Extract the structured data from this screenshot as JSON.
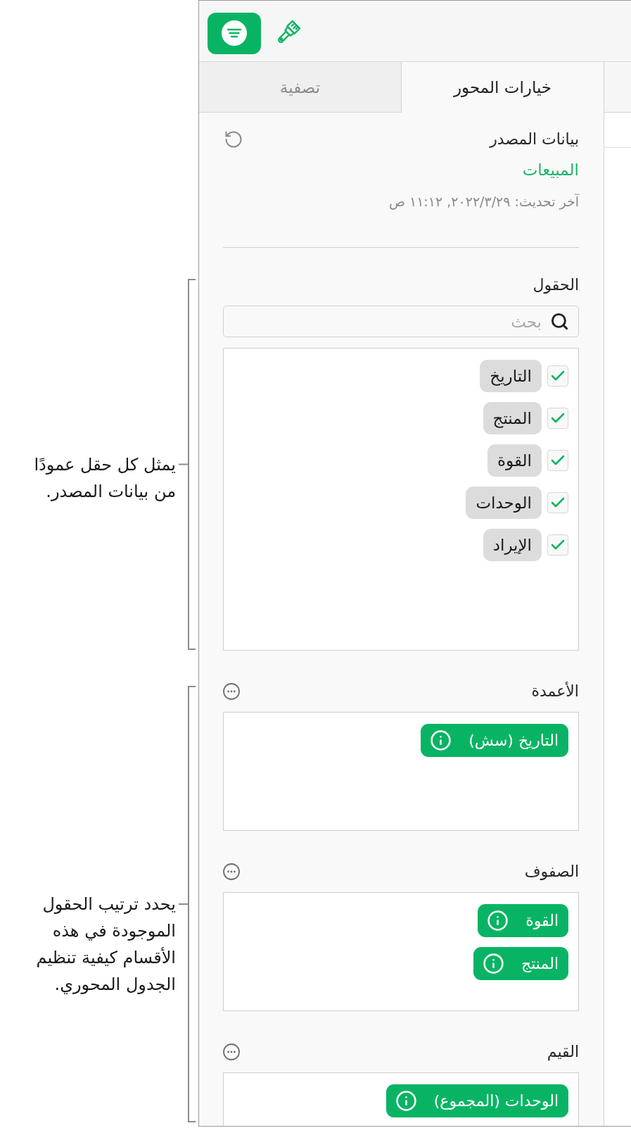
{
  "toolbar": {
    "buttons": [
      {
        "kind": "organize",
        "selected": true
      },
      {
        "kind": "format",
        "selected": false
      }
    ]
  },
  "tabs": [
    {
      "label": "خيارات المحور",
      "selected": true
    },
    {
      "label": "تصفية",
      "selected": false
    }
  ],
  "source_data": {
    "heading": "بيانات المصدر",
    "table_name": "المبيعات",
    "last_updated": "آخر تحديث: ٢٠٢٢/٣/٢٩, ١١:١٢ ص"
  },
  "fields": {
    "heading": "الحقول",
    "search": {
      "placeholder": "بحث"
    },
    "items": [
      {
        "label": "التاريخ",
        "checked": true
      },
      {
        "label": "المنتج",
        "checked": true
      },
      {
        "label": "القوة",
        "checked": true
      },
      {
        "label": "الوحدات",
        "checked": true
      },
      {
        "label": "الإيراد",
        "checked": true
      }
    ]
  },
  "columns": {
    "heading": "الأعمدة",
    "items": [
      "التاريخ (سش)"
    ]
  },
  "rows": {
    "heading": "الصفوف",
    "items": [
      "القوة",
      "المنتج"
    ]
  },
  "values": {
    "heading": "القيم",
    "items": [
      "الوحدات (المجموع)"
    ]
  },
  "callouts": [
    {
      "text": "يمثل كل حقل عمودًا من بيانات المصدر."
    },
    {
      "text": "يحدد ترتيب الحقول الموجودة في هذه الأقسام كيفية تنظيم الجدول المحوري."
    }
  ]
}
